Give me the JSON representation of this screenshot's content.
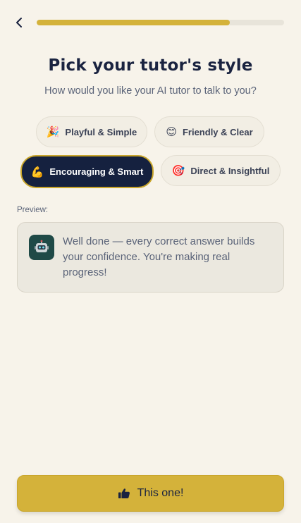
{
  "header": {
    "back_icon": "chevron-left-icon",
    "progress": 0.78,
    "progress_color": "#d4b23a"
  },
  "title": "Pick your tutor's style",
  "subtitle": "How would you like your AI tutor to talk to you?",
  "styles": [
    {
      "emoji": "🎉",
      "icon": "party-popper-icon",
      "label": "Playful & Simple",
      "selected": false
    },
    {
      "emoji": "😊",
      "icon": "smiling-face-icon",
      "label": "Friendly & Clear",
      "selected": false
    },
    {
      "emoji": "💪",
      "icon": "flexed-biceps-icon",
      "label": "Encouraging & Smart",
      "selected": true
    },
    {
      "emoji": "🎯",
      "icon": "target-icon",
      "label": "Direct & Insightful",
      "selected": false
    }
  ],
  "preview": {
    "label": "Preview:",
    "avatar_icon": "robot-icon",
    "message": "Well done — every correct answer builds your confidence. You're making real progress!"
  },
  "cta": {
    "icon": "thumbs-up-icon",
    "label": "This one!"
  },
  "colors": {
    "background": "#f7f3ea",
    "accent": "#d4b23a",
    "selected_chip": "#15213f",
    "text": "#1a2340"
  }
}
